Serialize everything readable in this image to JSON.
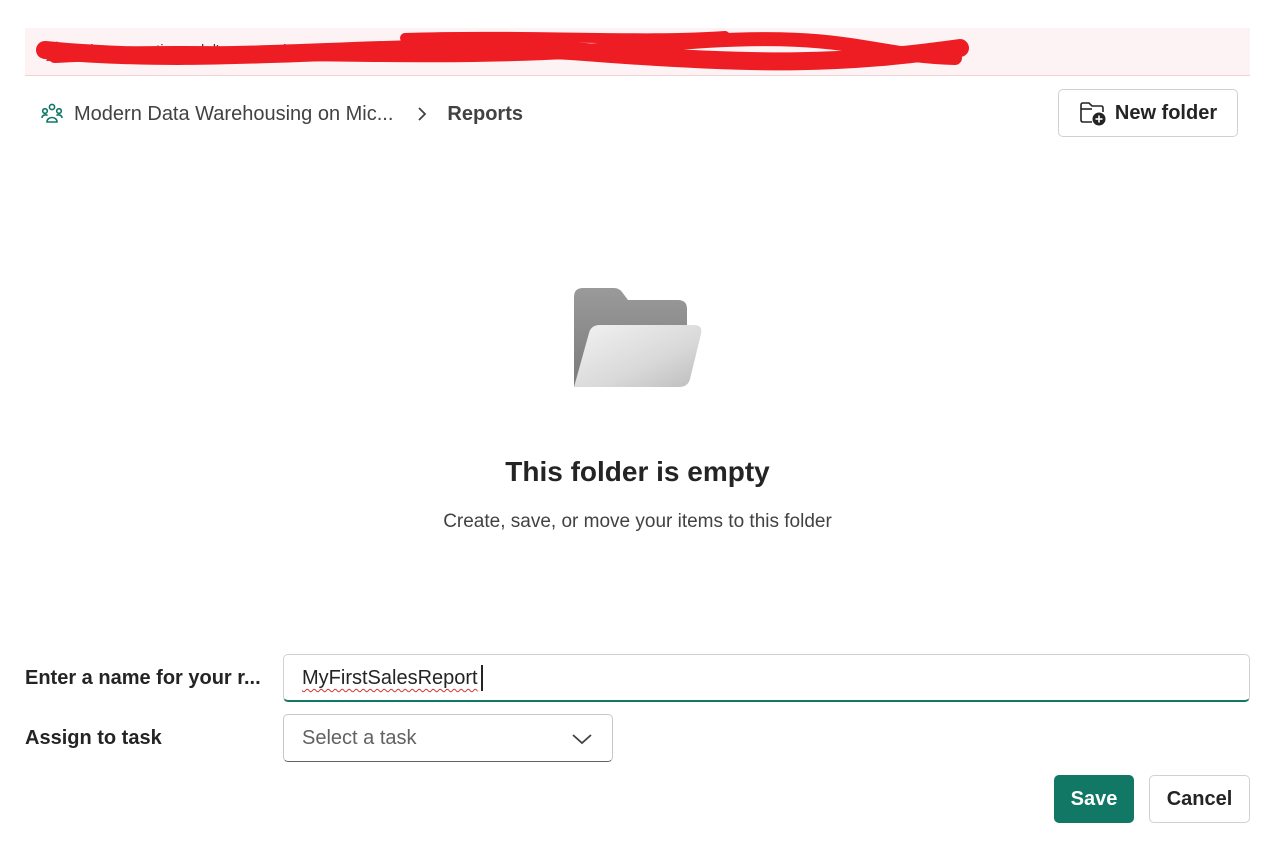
{
  "banner": {
    "icon": "warning-icon",
    "text": "The semantic model's connection ... will be",
    "accent_color": "#c50f1f"
  },
  "breadcrumb": {
    "workspace_icon": "workspace-icon",
    "workspace": "Modern Data Warehousing on Mic...",
    "separator_icon": "chevron-right-icon",
    "current": "Reports"
  },
  "toolbar": {
    "new_folder_icon": "folder-add-icon",
    "new_folder_label": "New folder"
  },
  "empty_state": {
    "icon": "open-folder-icon",
    "title": "This folder is empty",
    "subtitle": "Create, save, or move your items to this folder"
  },
  "form": {
    "name_label": "Enter a name for your r...",
    "name_value": "MyFirstSalesReport",
    "task_label": "Assign to task",
    "task_placeholder": "Select a task",
    "task_chevron_icon": "chevron-down-icon"
  },
  "actions": {
    "save_label": "Save",
    "cancel_label": "Cancel",
    "primary_color": "#117865"
  }
}
